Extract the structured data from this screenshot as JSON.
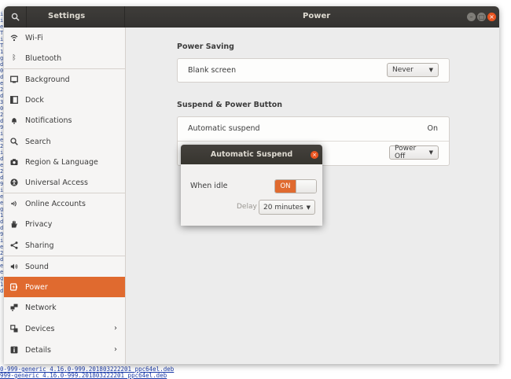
{
  "background": {
    "left_fragments": [
      "i",
      "i",
      "e",
      "T",
      "i",
      "T",
      "1",
      "g",
      "d",
      "0",
      "d",
      "e",
      "2",
      "d",
      "3",
      "0",
      "2",
      "d",
      "9",
      "i",
      "e",
      "2",
      "i",
      "d",
      "e",
      "2",
      "d",
      "9",
      "i",
      "e",
      "e",
      "g",
      "1",
      "d",
      "d",
      "9",
      "i",
      "e",
      "2",
      "d",
      "e",
      "e",
      "g",
      "1",
      "d"
    ],
    "bottom_lines": [
      "0-999-generic_4.16.0-999.201803222201_ppc64el.deb",
      "999-generic_4.16.0-999.201803222201_ppc64el.deb"
    ]
  },
  "window": {
    "sidebar_title": "Settings",
    "title": "Power",
    "controls": [
      "minimize-icon",
      "maximize-icon",
      "close-icon"
    ]
  },
  "sidebar": {
    "items": [
      {
        "label": "Wi-Fi",
        "icon": "wifi-icon"
      },
      {
        "label": "Bluetooth",
        "icon": "bluetooth-icon"
      },
      {
        "label": "Background",
        "icon": "background-icon"
      },
      {
        "label": "Dock",
        "icon": "dock-icon"
      },
      {
        "label": "Notifications",
        "icon": "bell-icon"
      },
      {
        "label": "Search",
        "icon": "search-icon"
      },
      {
        "label": "Region & Language",
        "icon": "camera-icon"
      },
      {
        "label": "Universal Access",
        "icon": "accessibility-icon"
      },
      {
        "label": "Online Accounts",
        "icon": "online-accounts-icon"
      },
      {
        "label": "Privacy",
        "icon": "hand-icon"
      },
      {
        "label": "Sharing",
        "icon": "share-icon"
      },
      {
        "label": "Sound",
        "icon": "speaker-icon"
      },
      {
        "label": "Power",
        "icon": "power-icon",
        "active": true
      },
      {
        "label": "Network",
        "icon": "network-icon"
      },
      {
        "label": "Devices",
        "icon": "devices-icon",
        "chevron": true
      },
      {
        "label": "Details",
        "icon": "details-icon",
        "chevron": true
      }
    ]
  },
  "power_saving": {
    "title": "Power Saving",
    "blank_screen_label": "Blank screen",
    "blank_screen_value": "Never"
  },
  "suspend": {
    "title": "Suspend & Power Button",
    "auto_suspend_label": "Automatic suspend",
    "auto_suspend_value": "On",
    "power_button_value": "Power Off"
  },
  "dialog": {
    "title": "Automatic Suspend",
    "when_idle_label": "When idle",
    "switch_label": "ON",
    "delay_label": "Delay",
    "delay_value": "20 minutes"
  },
  "colors": {
    "accent": "#e06a2f",
    "headerbar": "#3a3835",
    "close": "#e95420"
  }
}
